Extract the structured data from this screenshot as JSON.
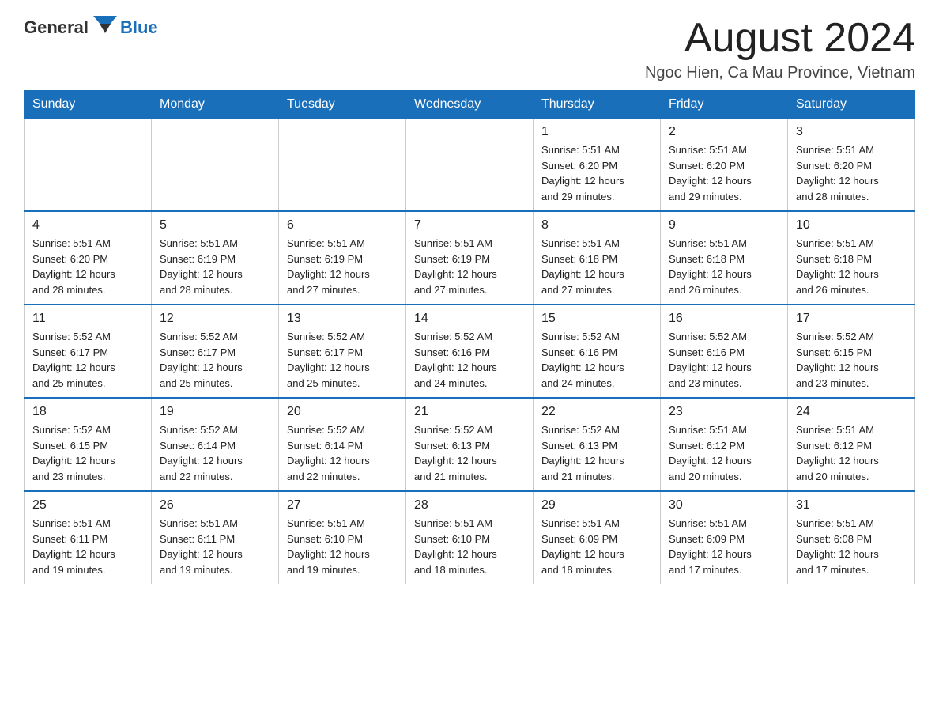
{
  "header": {
    "logo_general": "General",
    "logo_blue": "Blue",
    "month_year": "August 2024",
    "location": "Ngoc Hien, Ca Mau Province, Vietnam"
  },
  "weekdays": [
    "Sunday",
    "Monday",
    "Tuesday",
    "Wednesday",
    "Thursday",
    "Friday",
    "Saturday"
  ],
  "weeks": [
    [
      {
        "day": "",
        "info": ""
      },
      {
        "day": "",
        "info": ""
      },
      {
        "day": "",
        "info": ""
      },
      {
        "day": "",
        "info": ""
      },
      {
        "day": "1",
        "info": "Sunrise: 5:51 AM\nSunset: 6:20 PM\nDaylight: 12 hours\nand 29 minutes."
      },
      {
        "day": "2",
        "info": "Sunrise: 5:51 AM\nSunset: 6:20 PM\nDaylight: 12 hours\nand 29 minutes."
      },
      {
        "day": "3",
        "info": "Sunrise: 5:51 AM\nSunset: 6:20 PM\nDaylight: 12 hours\nand 28 minutes."
      }
    ],
    [
      {
        "day": "4",
        "info": "Sunrise: 5:51 AM\nSunset: 6:20 PM\nDaylight: 12 hours\nand 28 minutes."
      },
      {
        "day": "5",
        "info": "Sunrise: 5:51 AM\nSunset: 6:19 PM\nDaylight: 12 hours\nand 28 minutes."
      },
      {
        "day": "6",
        "info": "Sunrise: 5:51 AM\nSunset: 6:19 PM\nDaylight: 12 hours\nand 27 minutes."
      },
      {
        "day": "7",
        "info": "Sunrise: 5:51 AM\nSunset: 6:19 PM\nDaylight: 12 hours\nand 27 minutes."
      },
      {
        "day": "8",
        "info": "Sunrise: 5:51 AM\nSunset: 6:18 PM\nDaylight: 12 hours\nand 27 minutes."
      },
      {
        "day": "9",
        "info": "Sunrise: 5:51 AM\nSunset: 6:18 PM\nDaylight: 12 hours\nand 26 minutes."
      },
      {
        "day": "10",
        "info": "Sunrise: 5:51 AM\nSunset: 6:18 PM\nDaylight: 12 hours\nand 26 minutes."
      }
    ],
    [
      {
        "day": "11",
        "info": "Sunrise: 5:52 AM\nSunset: 6:17 PM\nDaylight: 12 hours\nand 25 minutes."
      },
      {
        "day": "12",
        "info": "Sunrise: 5:52 AM\nSunset: 6:17 PM\nDaylight: 12 hours\nand 25 minutes."
      },
      {
        "day": "13",
        "info": "Sunrise: 5:52 AM\nSunset: 6:17 PM\nDaylight: 12 hours\nand 25 minutes."
      },
      {
        "day": "14",
        "info": "Sunrise: 5:52 AM\nSunset: 6:16 PM\nDaylight: 12 hours\nand 24 minutes."
      },
      {
        "day": "15",
        "info": "Sunrise: 5:52 AM\nSunset: 6:16 PM\nDaylight: 12 hours\nand 24 minutes."
      },
      {
        "day": "16",
        "info": "Sunrise: 5:52 AM\nSunset: 6:16 PM\nDaylight: 12 hours\nand 23 minutes."
      },
      {
        "day": "17",
        "info": "Sunrise: 5:52 AM\nSunset: 6:15 PM\nDaylight: 12 hours\nand 23 minutes."
      }
    ],
    [
      {
        "day": "18",
        "info": "Sunrise: 5:52 AM\nSunset: 6:15 PM\nDaylight: 12 hours\nand 23 minutes."
      },
      {
        "day": "19",
        "info": "Sunrise: 5:52 AM\nSunset: 6:14 PM\nDaylight: 12 hours\nand 22 minutes."
      },
      {
        "day": "20",
        "info": "Sunrise: 5:52 AM\nSunset: 6:14 PM\nDaylight: 12 hours\nand 22 minutes."
      },
      {
        "day": "21",
        "info": "Sunrise: 5:52 AM\nSunset: 6:13 PM\nDaylight: 12 hours\nand 21 minutes."
      },
      {
        "day": "22",
        "info": "Sunrise: 5:52 AM\nSunset: 6:13 PM\nDaylight: 12 hours\nand 21 minutes."
      },
      {
        "day": "23",
        "info": "Sunrise: 5:51 AM\nSunset: 6:12 PM\nDaylight: 12 hours\nand 20 minutes."
      },
      {
        "day": "24",
        "info": "Sunrise: 5:51 AM\nSunset: 6:12 PM\nDaylight: 12 hours\nand 20 minutes."
      }
    ],
    [
      {
        "day": "25",
        "info": "Sunrise: 5:51 AM\nSunset: 6:11 PM\nDaylight: 12 hours\nand 19 minutes."
      },
      {
        "day": "26",
        "info": "Sunrise: 5:51 AM\nSunset: 6:11 PM\nDaylight: 12 hours\nand 19 minutes."
      },
      {
        "day": "27",
        "info": "Sunrise: 5:51 AM\nSunset: 6:10 PM\nDaylight: 12 hours\nand 19 minutes."
      },
      {
        "day": "28",
        "info": "Sunrise: 5:51 AM\nSunset: 6:10 PM\nDaylight: 12 hours\nand 18 minutes."
      },
      {
        "day": "29",
        "info": "Sunrise: 5:51 AM\nSunset: 6:09 PM\nDaylight: 12 hours\nand 18 minutes."
      },
      {
        "day": "30",
        "info": "Sunrise: 5:51 AM\nSunset: 6:09 PM\nDaylight: 12 hours\nand 17 minutes."
      },
      {
        "day": "31",
        "info": "Sunrise: 5:51 AM\nSunset: 6:08 PM\nDaylight: 12 hours\nand 17 minutes."
      }
    ]
  ]
}
